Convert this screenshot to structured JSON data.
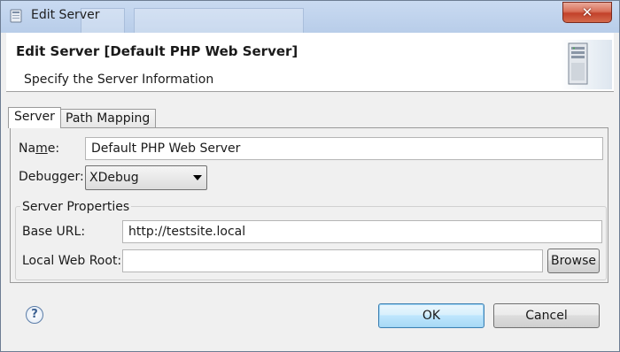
{
  "window": {
    "title": "Edit Server",
    "close_glyph": "✕"
  },
  "header": {
    "title": "Edit Server [Default PHP Web Server]",
    "subtitle": "Specify the Server Information",
    "icon": "server-icon"
  },
  "tabs": [
    {
      "label": "Server",
      "active": true
    },
    {
      "label": "Path Mapping",
      "active": false
    }
  ],
  "form": {
    "name_label_pre": "Na",
    "name_label_accel": "m",
    "name_label_post": "e:",
    "name_value": "Default PHP Web Server",
    "debugger_label": "Debugger:",
    "debugger_value": "XDebug",
    "group_label": "Server Properties",
    "base_url_label": "Base URL:",
    "base_url_value": "http://testsite.local",
    "web_root_label": "Local Web Root:",
    "web_root_value": "",
    "browse_label": "Browse"
  },
  "footer": {
    "help_glyph": "?",
    "ok_label": "OK",
    "cancel_label": "Cancel"
  },
  "colors": {
    "titlebar": "#b8cde9",
    "close_button": "#c2412a",
    "default_button_border": "#3c7fb1"
  }
}
